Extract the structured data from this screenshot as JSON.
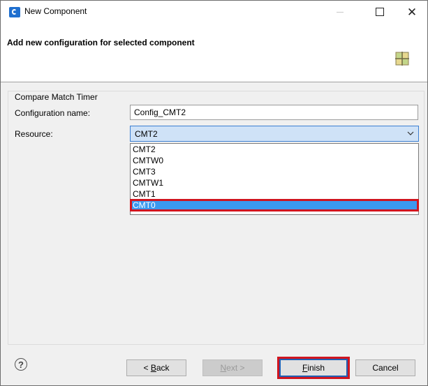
{
  "window": {
    "title": "New Component"
  },
  "header": {
    "title": "Add new configuration for selected component"
  },
  "group": {
    "label": "Compare Match Timer"
  },
  "fields": {
    "config_name_label": "Configuration name:",
    "config_name_value": "Config_CMT2",
    "resource_label": "Resource:",
    "resource_value": "CMT2"
  },
  "dropdown": {
    "options": [
      "CMT2",
      "CMTW0",
      "CMT3",
      "CMTW1",
      "CMT1",
      "CMT0"
    ],
    "highlighted": "CMT0"
  },
  "buttons": {
    "help": "?",
    "back_pre": "< ",
    "back_key": "B",
    "back_post": "ack",
    "next_key": "N",
    "next_post": "ext >",
    "finish_key": "F",
    "finish_post": "inish",
    "cancel": "Cancel"
  },
  "colors": {
    "selection": "#3b99f0",
    "highlight_border": "#d0151f",
    "combo_bg": "#cfe2f7"
  }
}
